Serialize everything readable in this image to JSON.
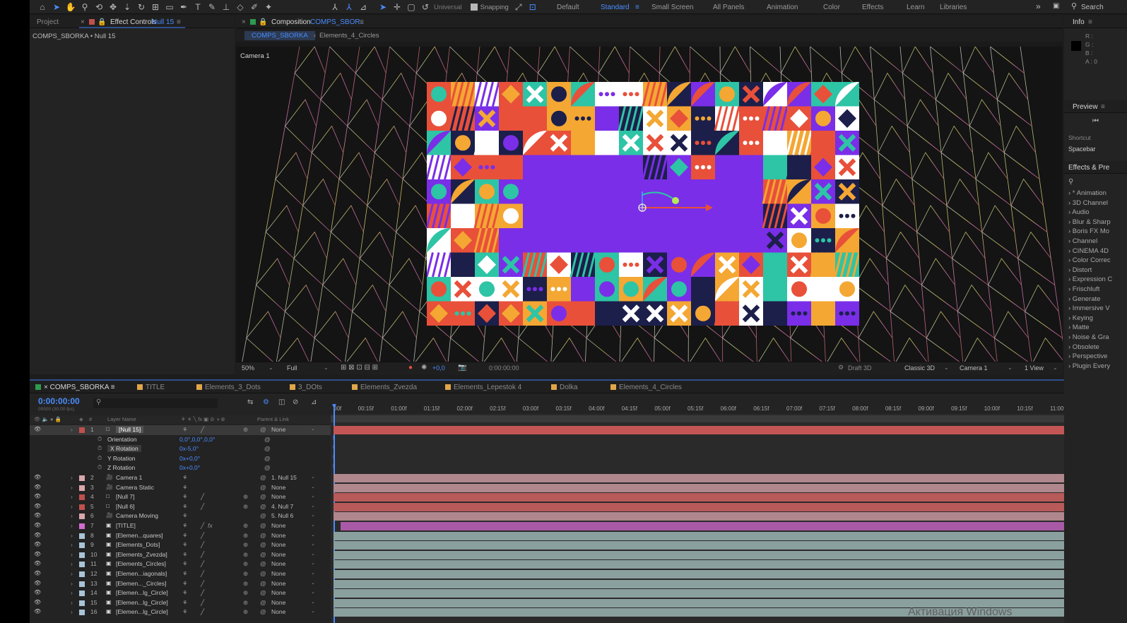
{
  "toolbar": {
    "universal_label": "Universal",
    "snapping_label": "Snapping",
    "workspaces": [
      {
        "label": "Default",
        "active": false
      },
      {
        "label": "Standard",
        "active": true
      },
      {
        "label": "Small Screen",
        "active": false
      },
      {
        "label": "All Panels",
        "active": false
      },
      {
        "label": "Animation",
        "active": false
      },
      {
        "label": "Color",
        "active": false
      },
      {
        "label": "Effects",
        "active": false
      },
      {
        "label": "Learn",
        "active": false
      },
      {
        "label": "Libraries",
        "active": false
      }
    ],
    "search_label": "Search"
  },
  "project_panel": {
    "tab_project": "Project",
    "tab_effect_controls": "Effect Controls",
    "effect_controls_target": "Null 15",
    "breadcrumb": "COMPS_SBORKA • Null 15"
  },
  "comp_panel": {
    "tab_label": "Composition",
    "tab_comp_name": "COMPS_SBOR..",
    "sub_tabs": [
      "COMPS_SBORKA",
      "Elements_4_Circles"
    ],
    "camera_label": "Camera 1",
    "zoom": "50%",
    "resolution": "Full",
    "exposure": "+0,0",
    "timecode": "0:00:00:00",
    "draft_3d": "Draft 3D",
    "renderer": "Classic 3D",
    "active_camera": "Camera 1",
    "views": "1 View"
  },
  "right_panel": {
    "info_title": "Info",
    "info_channels": [
      "R :",
      "G :",
      "B :",
      "A : 0"
    ],
    "preview_title": "Preview",
    "shortcut_label": "Shortcut",
    "shortcut_value": "Spacebar",
    "effects_title": "Effects & Pre",
    "effects_list": [
      "* Animation",
      "3D Channel",
      "Audio",
      "Blur & Sharp",
      "Boris FX Mo",
      "Channel",
      "CINEMA 4D",
      "Color Correc",
      "Distort",
      "Expression C",
      "Frischluft",
      "Generate",
      "Immersive V",
      "Keying",
      "Matte",
      "Noise & Gra",
      "Obsolete",
      "Perspective",
      "Plugin Every"
    ]
  },
  "timeline": {
    "tabs": [
      "COMPS_SBORKA",
      "TITLE",
      "Elements_3_Dots",
      "3_DOts",
      "Elements_Zvezda",
      "Elements_Lepestok 4",
      "Dolka",
      "Elements_4_Circles"
    ],
    "timecode": "0:00:00:00",
    "fps_info": "00000 (30.00 fps)",
    "col_layer_name": "Layer Name",
    "col_parent": "Parent & Link",
    "ruler": [
      "00f",
      "00:15f",
      "01:00f",
      "01:15f",
      "02:00f",
      "02:15f",
      "03:00f",
      "03:15f",
      "04:00f",
      "04:15f",
      "05:00f",
      "05:15f",
      "06:00f",
      "06:15f",
      "07:00f",
      "07:15f",
      "08:00f",
      "08:15f",
      "09:00f",
      "09:15f",
      "10:00f",
      "10:15f",
      "11:00f"
    ],
    "layers": [
      {
        "num": "1",
        "name": "[Null 15]",
        "color": "#c0504d",
        "parent": "None",
        "selected": true,
        "type": "null"
      },
      {
        "prop": "Orientation",
        "value": "0,0°,0,0°,0,0°"
      },
      {
        "prop": "X Rotation",
        "value": "0x-5,0°",
        "selected": true
      },
      {
        "prop": "Y Rotation",
        "value": "0x+0,0°"
      },
      {
        "prop": "Z Rotation",
        "value": "0x+0,0°"
      },
      {
        "num": "2",
        "name": "Camera 1",
        "color": "#d9a7ad",
        "parent": "1. Null 15",
        "type": "camera"
      },
      {
        "num": "3",
        "name": "Camera Static",
        "color": "#d9a7ad",
        "parent": "None",
        "type": "camera"
      },
      {
        "num": "4",
        "name": "[Null 7]",
        "color": "#c0504d",
        "parent": "None",
        "type": "null"
      },
      {
        "num": "5",
        "name": "[Null 6]",
        "color": "#c0504d",
        "parent": "4. Null 7",
        "type": "null"
      },
      {
        "num": "6",
        "name": "Camera Moving",
        "color": "#d9a7ad",
        "parent": "5. Null 6",
        "type": "camera"
      },
      {
        "num": "7",
        "name": "[TITLE]",
        "color": "#d36bd0",
        "parent": "None",
        "type": "comp"
      },
      {
        "num": "8",
        "name": "[Elemen...quares]",
        "color": "#a9c4d6",
        "parent": "None",
        "type": "comp"
      },
      {
        "num": "9",
        "name": "[Elements_Dots]",
        "color": "#a9c4d6",
        "parent": "None",
        "type": "comp"
      },
      {
        "num": "10",
        "name": "[Elements_Zvezda]",
        "color": "#a9c4d6",
        "parent": "None",
        "type": "comp"
      },
      {
        "num": "11",
        "name": "[Elements_Circles]",
        "color": "#a9c4d6",
        "parent": "None",
        "type": "comp"
      },
      {
        "num": "12",
        "name": "[Elemen...iagonals]",
        "color": "#a9c4d6",
        "parent": "None",
        "type": "comp"
      },
      {
        "num": "13",
        "name": "[Elemen..._Circles]",
        "color": "#a9c4d6",
        "parent": "None",
        "type": "comp"
      },
      {
        "num": "14",
        "name": "[Elemen...lg_Circle]",
        "color": "#a9c4d6",
        "parent": "None",
        "type": "comp"
      },
      {
        "num": "15",
        "name": "[Elemen...lg_Circle]",
        "color": "#a9c4d6",
        "parent": "None",
        "type": "comp"
      },
      {
        "num": "16",
        "name": "[Elemen...lg_Circle]",
        "color": "#a9c4d6",
        "parent": "None",
        "type": "comp"
      }
    ]
  },
  "watermark": "Активация Windows",
  "colors": {
    "accent": "#4a8cff",
    "timeline_highlight": "#2d4e8c",
    "pattern": [
      "#ffffff",
      "#f4a733",
      "#e8503a",
      "#2ec4a6",
      "#1c1f4a",
      "#7a2ee8"
    ],
    "plane": "#7a2ee8"
  }
}
